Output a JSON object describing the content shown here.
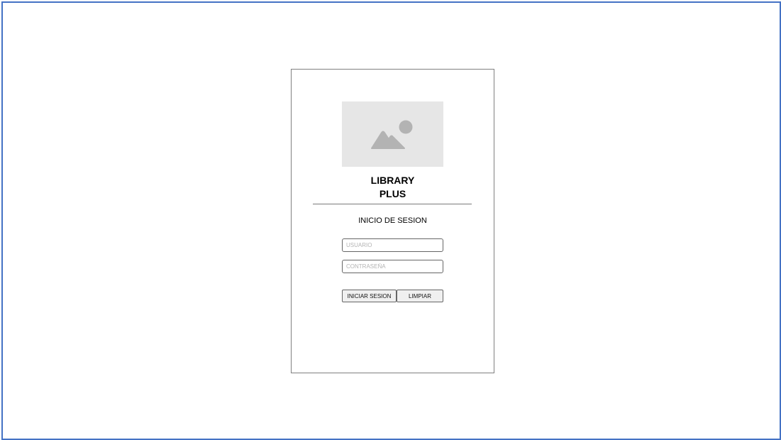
{
  "app": {
    "title_line1": "LIBRARY",
    "title_line2": "PLUS"
  },
  "login": {
    "heading": "INICIO DE SESION",
    "username_placeholder": "USUARIO",
    "password_placeholder": "CONTRASEÑA",
    "login_button": "INICIAR SESION",
    "clear_button": "LIMPIAR"
  },
  "logo": {
    "icon": "image-placeholder-icon",
    "background": "#e6e6e6",
    "icon_color": "#b3b3b3"
  },
  "colors": {
    "frame_border": "#4472c4",
    "card_border": "#808080"
  }
}
